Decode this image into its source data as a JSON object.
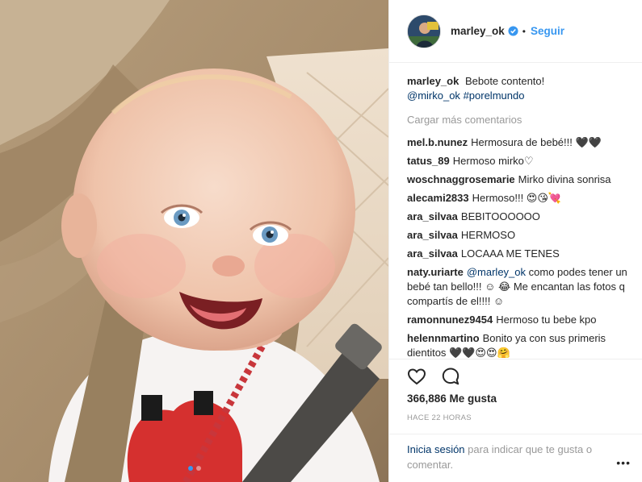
{
  "post": {
    "username": "marley_ok",
    "follow_label": "Seguir",
    "separator": "•",
    "caption_username": "marley_ok",
    "caption_text": "Bebote contento!",
    "caption_mention": "@mirko_ok",
    "caption_hashtag": "#porelmundo",
    "load_more_label": "Cargar más comentarios",
    "likes": "366,886 Me gusta",
    "time": "HACE 22 HORAS",
    "login_link": "Inicia sesión",
    "login_text": "para indicar que te gusta o comentar.",
    "more_label": "•••"
  },
  "comments": [
    {
      "user": "mel.b.nunez",
      "text": "Hermosura de bebé!!! 🖤🖤"
    },
    {
      "user": "tatus_89",
      "text": "Hermoso mirko♡"
    },
    {
      "user": "woschnaggrosemarie",
      "text": "Mirko divina sonrisa"
    },
    {
      "user": "alecami2833",
      "text": "Hermoso!!! 😍😘💘"
    },
    {
      "user": "ara_silvaa",
      "text": "BEBITOOOOOO"
    },
    {
      "user": "ara_silvaa",
      "text": "HERMOSO"
    },
    {
      "user": "ara_silvaa",
      "text": "LOCAAA ME TENES"
    },
    {
      "user": "naty.uriarte",
      "mention": "@marley_ok",
      "text": "como podes tener un bebé tan bello!!! ☺ 😂 Me encantan las fotos q compartís de el!!!! ☺"
    },
    {
      "user": "ramonnunez9454",
      "text": "Hermoso tu bebe kpo"
    },
    {
      "user": "helennmartino",
      "text": "Bonito ya con sus primeris dientitos 🖤🖤😍😍🤗"
    }
  ],
  "colors": {
    "link_blue": "#3897f0",
    "mention_blue": "#003569",
    "meta_gray": "#999999",
    "text_dark": "#262626"
  },
  "icons": [
    "verified-badge-icon",
    "heart-icon",
    "comment-icon",
    "more-options-icon"
  ]
}
